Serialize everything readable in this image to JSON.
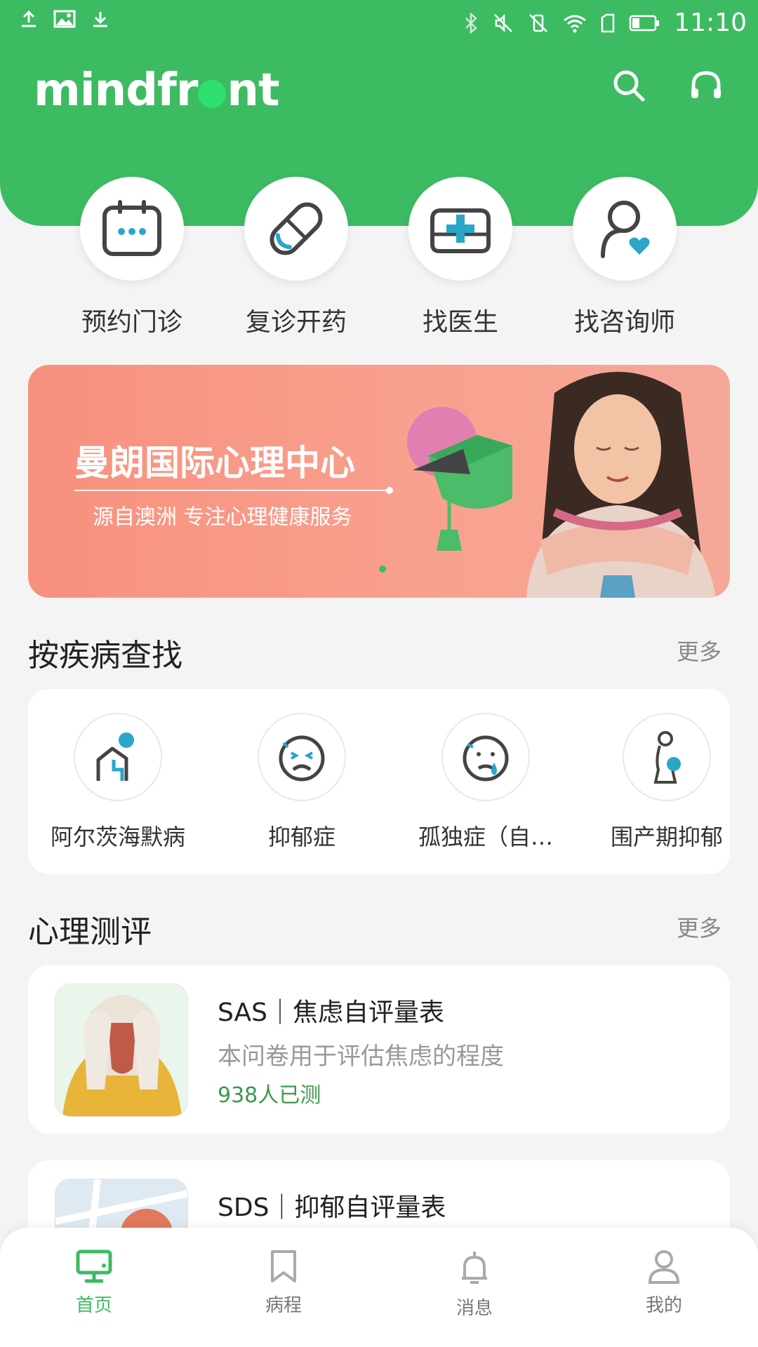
{
  "status_bar": {
    "time": "11:10"
  },
  "header": {
    "logo_text_1": "mindfr",
    "logo_text_2": "nt"
  },
  "quick_actions": [
    {
      "label": "预约门诊",
      "icon": "calendar-icon"
    },
    {
      "label": "复诊开药",
      "icon": "pill-icon"
    },
    {
      "label": "找医生",
      "icon": "medical-kit-icon"
    },
    {
      "label": "找咨询师",
      "icon": "counselor-icon"
    }
  ],
  "banner": {
    "title": "曼朗国际心理中心",
    "subtitle": "源自澳洲 专注心理健康服务"
  },
  "diseases": {
    "title": "按疾病查找",
    "more": "更多",
    "items": [
      {
        "label": "阿尔茨海默病",
        "icon": "elderly-person-icon"
      },
      {
        "label": "抑郁症",
        "icon": "sad-face-icon"
      },
      {
        "label": "孤独症（自…",
        "icon": "crying-face-icon"
      },
      {
        "label": "围产期抑郁",
        "icon": "pregnant-woman-icon"
      }
    ]
  },
  "evaluations": {
    "title": "心理测评",
    "more": "更多",
    "items": [
      {
        "title": "SAS｜焦虑自评量表",
        "desc": "本问卷用于评估焦虑的程度",
        "count": "938人已测"
      },
      {
        "title": "SDS｜抑郁自评量表"
      }
    ]
  },
  "bottom_nav": [
    {
      "label": "首页",
      "active": true
    },
    {
      "label": "病程",
      "active": false
    },
    {
      "label": "消息",
      "active": false
    },
    {
      "label": "我的",
      "active": false
    }
  ],
  "colors": {
    "brand_green": "#3dbb63",
    "banner_coral": "#f8907e",
    "accent_teal": "#2aa6c9"
  }
}
